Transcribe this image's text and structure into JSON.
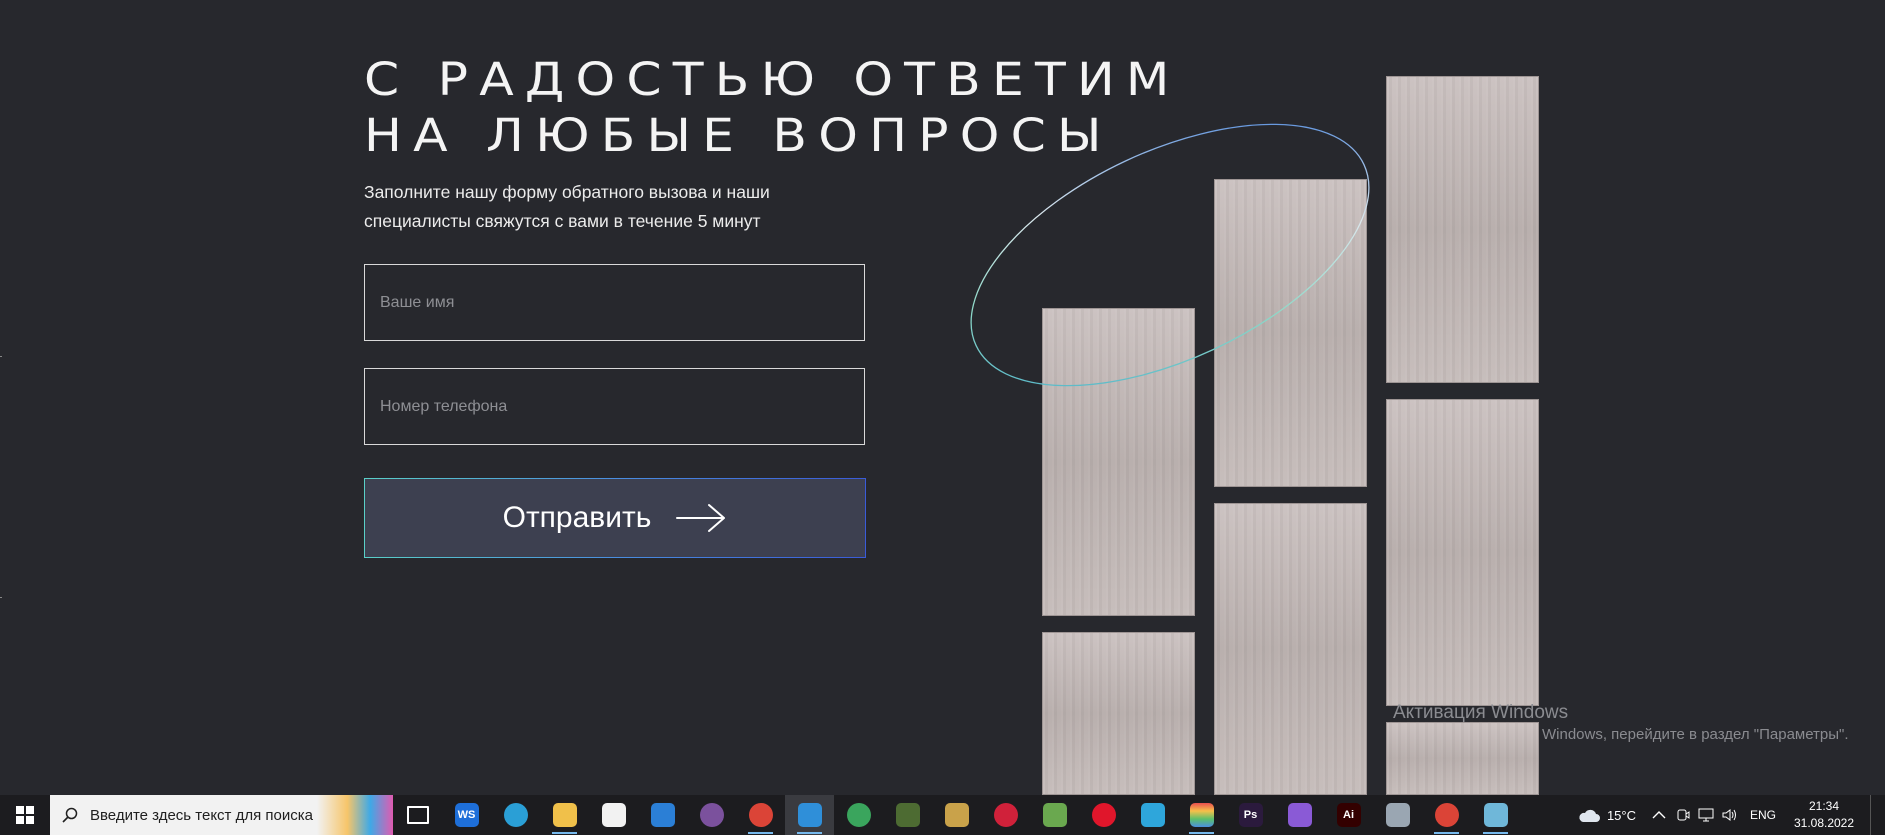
{
  "heading": {
    "line1": "С РАДОСТЬЮ ОТВЕТИМ",
    "line2": "НА ЛЮБЫЕ ВОПРОСЫ"
  },
  "subtitle": {
    "line1": "Заполните нашу форму обратного вызова и наши",
    "line2": "специалисты свяжутся с вами в течение 5 минут"
  },
  "form": {
    "name_placeholder": "Ваше имя",
    "phone_placeholder": "Номер телефона",
    "submit_label": "Отправить"
  },
  "watermark": {
    "title": "Активация Windows",
    "text": "Windows, перейдите в раздел \"Параметры\"."
  },
  "taskbar": {
    "search_placeholder": "Введите здесь текст для поиска",
    "apps": [
      {
        "name": "task-view-icon",
        "label": "",
        "color": "#1c1c1f"
      },
      {
        "name": "webstorm-icon",
        "label": "WS",
        "color": "#1e6fd9"
      },
      {
        "name": "edge-icon",
        "label": "",
        "color": "#2a9fd6"
      },
      {
        "name": "file-explorer-icon",
        "label": "",
        "color": "#f0c04a"
      },
      {
        "name": "store-icon",
        "label": "",
        "color": "#f2f2f2"
      },
      {
        "name": "mail-icon",
        "label": "",
        "color": "#2b7fd6"
      },
      {
        "name": "viber-icon",
        "label": "",
        "color": "#7b519d"
      },
      {
        "name": "chrome-icon",
        "label": "",
        "color": "#db4437"
      },
      {
        "name": "vscode-icon",
        "label": "",
        "color": "#2f8fd9"
      },
      {
        "name": "app-green-icon",
        "label": "",
        "color": "#3aa55d"
      },
      {
        "name": "minecraft-icon",
        "label": "",
        "color": "#4d6b32"
      },
      {
        "name": "lock-app-icon",
        "label": "",
        "color": "#c9a24a"
      },
      {
        "name": "opera-icon",
        "label": "",
        "color": "#d0213a"
      },
      {
        "name": "notepad-icon",
        "label": "",
        "color": "#6aa84f"
      },
      {
        "name": "opera-gx-icon",
        "label": "",
        "color": "#e0162b"
      },
      {
        "name": "telegram-icon",
        "label": "",
        "color": "#2ea6db"
      },
      {
        "name": "rainbow-app-icon",
        "label": "",
        "color": "#e94e77"
      },
      {
        "name": "photoshop-icon",
        "label": "Ps",
        "color": "#2b1a3d"
      },
      {
        "name": "feather-app-icon",
        "label": "",
        "color": "#8a5ad6"
      },
      {
        "name": "illustrator-icon",
        "label": "Ai",
        "color": "#330000"
      },
      {
        "name": "paint-app-icon",
        "label": "",
        "color": "#9aa6b2"
      },
      {
        "name": "chrome-2-icon",
        "label": "",
        "color": "#db4437"
      },
      {
        "name": "disk-app-icon",
        "label": "",
        "color": "#6fb7d9"
      }
    ],
    "weather": "15°C",
    "language": "ENG",
    "time": "21:34",
    "date": "31.08.2022"
  }
}
